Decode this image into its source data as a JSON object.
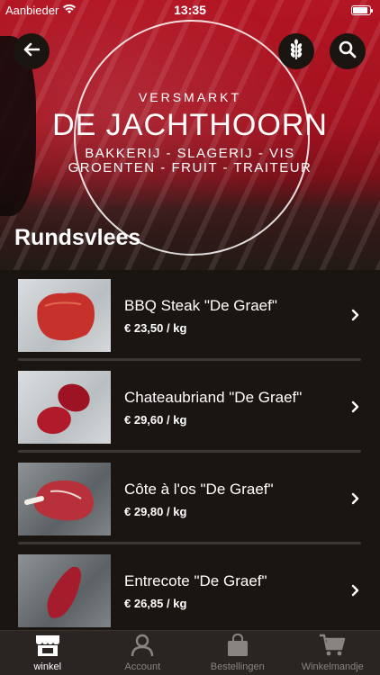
{
  "status_bar": {
    "carrier": "Aanbieder",
    "time": "13:35",
    "battery_level": 0.9
  },
  "hero": {
    "logo_top": "VERSMARKT",
    "logo_main": "DE JACHTHOORN",
    "logo_line1": "BAKKERIJ  -  SLAGERIJ  -  VIS",
    "logo_line2": "GROENTEN - FRUIT - TRAITEUR"
  },
  "header": {
    "back_icon": "arrow-left-icon",
    "filter_icon": "wheat-icon",
    "search_icon": "search-icon"
  },
  "page": {
    "title": "Rundsvlees"
  },
  "products": [
    {
      "name": "BBQ Steak \"De Graef\"",
      "price": "€ 23,50 / kg"
    },
    {
      "name": "Chateaubriand \"De Graef\"",
      "price": "€ 29,60 / kg"
    },
    {
      "name": "Côte à l'os \"De Graef\"",
      "price": "€ 29,80 / kg"
    },
    {
      "name": "Entrecote \"De Graef\"",
      "price": "€ 26,85 / kg"
    }
  ],
  "tabbar": {
    "tabs": [
      {
        "label": "winkel",
        "icon": "store-icon",
        "active": true
      },
      {
        "label": "Account",
        "icon": "user-icon",
        "active": false
      },
      {
        "label": "Bestellingen",
        "icon": "bag-icon",
        "active": false
      },
      {
        "label": "Winkelmandje",
        "icon": "cart-icon",
        "active": false
      }
    ]
  },
  "colors": {
    "background": "#1b1511",
    "hero_red": "#b31523",
    "tabbar": "#2a2522",
    "inactive_tab": "#8a8480",
    "separator": "#3b3733"
  }
}
